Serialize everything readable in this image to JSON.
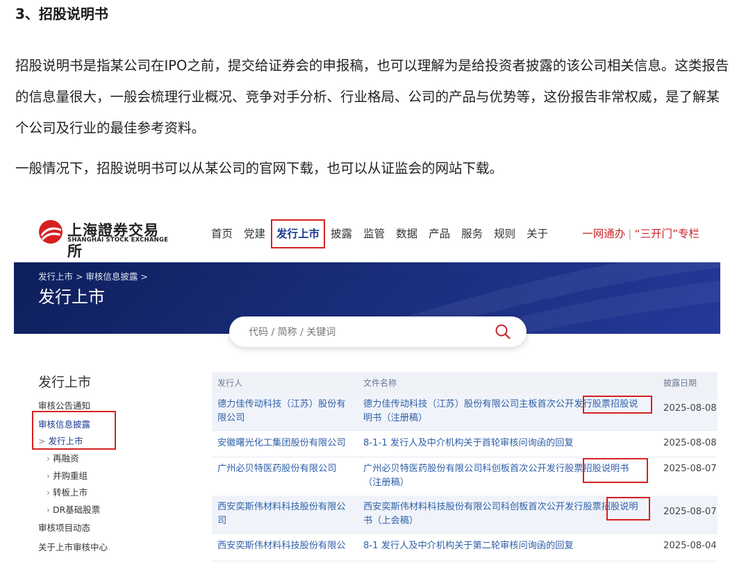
{
  "article": {
    "heading": "3、招股说明书",
    "paragraph1": "招股说明书是指某公司在IPO之前，提交给证券会的申报稿，也可以理解为是给投资者披露的该公司相关信息。这类报告的信息量很大，一般会梳理行业概况、竞争对手分析、行业格局、公司的产品与优势等，这份报告非常权威，是了解某个公司及行业的最佳参考资料。",
    "paragraph2": "一般情况下，招股说明书可以从某公司的官网下载，也可以从证监会的网站下载。"
  },
  "sse": {
    "logo_cn": "上海證券交易所",
    "logo_en": "SHANGHAI STOCK EXCHANGE",
    "logo_icon": "sse-logo-icon",
    "nav": [
      "首页",
      "党建",
      "发行上市",
      "披露",
      "监管",
      "数据",
      "产品",
      "服务",
      "规则",
      "关于"
    ],
    "quick_link_1": "一网通办",
    "quick_link_2": "“三开门”专栏",
    "breadcrumb": "发行上市 > 审核信息披露 >",
    "banner_title": "发行上市",
    "search_placeholder": "代码 / 简称 / 关键词",
    "search_icon": "search-icon",
    "sidebar_title": "发行上市",
    "sidebar": [
      "审核公告通知",
      "审核信息披露",
      "发行上市",
      "再融资",
      "并购重组",
      "转板上市",
      "DR基础股票",
      "审核项目动态",
      "关于上市审核中心"
    ],
    "table_headers": [
      "发行人",
      "文件名称",
      "披露日期"
    ],
    "rows": [
      {
        "issuer_1": "德力佳传动科技（江苏）股份有",
        "issuer_2": "限公司",
        "doc_1": "德力佳传动科技（江苏）股份有限公司主板首次公开发行股票招股说",
        "doc_2": "明书（注册稿）",
        "date": "2025-08-08"
      },
      {
        "issuer_1": "安徽曙光化工集团股份有限公司",
        "issuer_2": "",
        "doc_1": "8-1-1 发行人及中介机构关于首轮审核问询函的回复",
        "doc_2": "",
        "date": "2025-08-08"
      },
      {
        "issuer_1": "广州必贝特医药股份有限公司",
        "issuer_2": "",
        "doc_1": "广州必贝特医药股份有限公司科创板首次公开发行股票招股说明书",
        "doc_2": "（注册稿）",
        "date": "2025-08-07"
      },
      {
        "issuer_1": "西安奕斯伟材料科技股份有限公",
        "issuer_2": "司",
        "doc_1": "西安奕斯伟材料科技股份有限公司科创板首次公开发行股票招股说明",
        "doc_2": "书（上会稿）",
        "date": "2025-08-07"
      },
      {
        "issuer_1": "西安奕斯伟材料科技股份有限公",
        "issuer_2": "",
        "doc_1": "8-1 发行人及中介机构关于第二轮审核问询函的回复",
        "doc_2": "",
        "date": "2025-08-04"
      }
    ],
    "colors": {
      "brand_red": "#d62020",
      "banner_blue": "#1b2f7e",
      "link_blue": "#2f5fa8"
    }
  }
}
